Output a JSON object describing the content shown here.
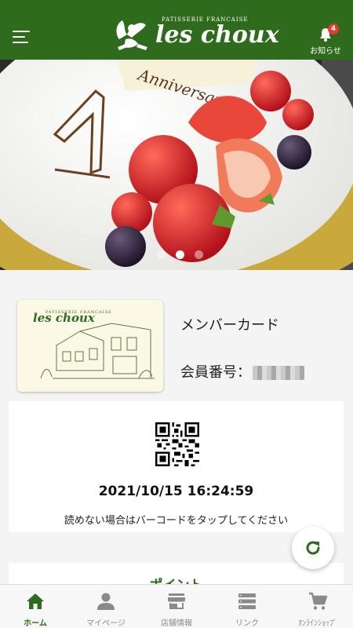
{
  "header": {
    "logo_sub": "PATISSERIE FRANCAISE",
    "logo_main": "les choux",
    "notice_label": "お知らせ",
    "notice_badge": "4"
  },
  "hero": {
    "slide_count": 3,
    "active_slide": 1,
    "cake_text": "Anniversary"
  },
  "member_card": {
    "card_logo_sub": "PATISSERIE FRANCAISE",
    "card_logo_main": "les choux",
    "title": "メンバーカード",
    "number_label": "会員番号："
  },
  "qr_panel": {
    "timestamp": "2021/10/15 16:24:59",
    "note": "読めない場合はバーコードをタップしてください"
  },
  "points": {
    "title": "ポイント"
  },
  "tabs": [
    {
      "label": "ホーム",
      "icon": "home-icon",
      "active": true
    },
    {
      "label": "マイページ",
      "icon": "person-icon",
      "active": false
    },
    {
      "label": "店舗情報",
      "icon": "store-icon",
      "active": false
    },
    {
      "label": "リンク",
      "icon": "list-icon",
      "active": false
    },
    {
      "label": "ｵﾝﾗｲﾝｼｮｯﾌﾟ",
      "icon": "cart-icon",
      "active": false
    }
  ],
  "colors": {
    "brand_green": "#2f6b1c",
    "badge_red": "#e53935",
    "inactive_tab": "#8a8a8a"
  }
}
